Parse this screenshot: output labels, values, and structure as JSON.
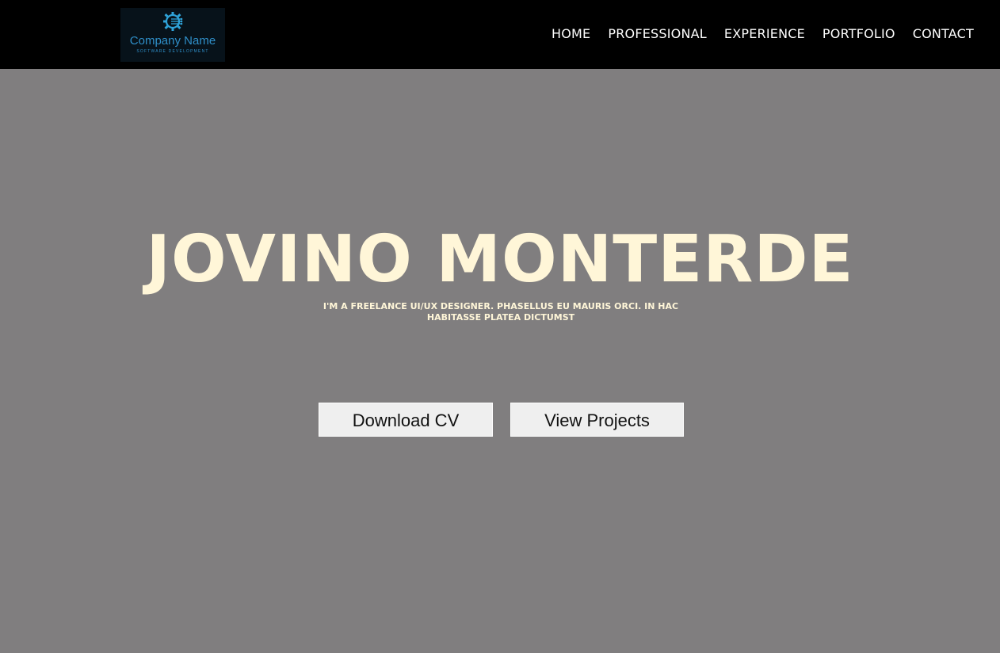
{
  "header": {
    "logo": {
      "company_name": "Company Name",
      "tagline": "SOFTWARE DEVELOPMENT",
      "icon": "gear-circuit-icon",
      "brand_color": "#2f8fc9"
    },
    "nav": [
      {
        "label": "HOME"
      },
      {
        "label": "PROFESSIONAL"
      },
      {
        "label": "EXPERIENCE"
      },
      {
        "label": "PORTFOLIO"
      },
      {
        "label": "CONTACT"
      }
    ]
  },
  "hero": {
    "title": "JOVINO MONTERDE",
    "subtitle": "I'M A FREELANCE UI/UX DESIGNER. PHASELLUS EU MAURIS ORCI. IN HAC HABITASSE PLATEA DICTUMST",
    "buttons": {
      "download_cv": "Download CV",
      "view_projects": "View Projects"
    }
  },
  "colors": {
    "navbar_bg": "#000000",
    "hero_bg": "#807e7f",
    "hero_text": "#fff6d8",
    "button_bg": "#efefef"
  }
}
